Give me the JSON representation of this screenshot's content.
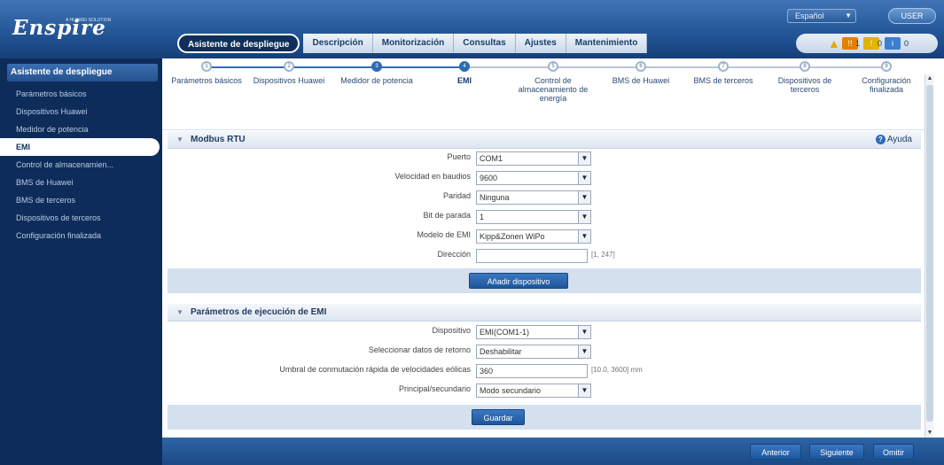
{
  "header": {
    "logo_text": "Enspire",
    "logo_subtext": "A HUAWEI SOLUTION",
    "language": "Español",
    "user": "USER"
  },
  "nav": {
    "tabs": [
      {
        "label": "Asistente de despliegue"
      },
      {
        "label": "Descripción"
      },
      {
        "label": "Monitorización"
      },
      {
        "label": "Consultas"
      },
      {
        "label": "Ajustes"
      },
      {
        "label": "Mantenimiento"
      }
    ],
    "alarms": {
      "major": "!!",
      "major_count": "1",
      "minor": "!",
      "minor_count": "0",
      "warning": "i",
      "warning_count": "0"
    }
  },
  "sidebar": {
    "title": "Asistente de despliegue",
    "items": [
      {
        "label": "Parámetros básicos"
      },
      {
        "label": "Dispositivos Huawei"
      },
      {
        "label": "Medidor de potencia"
      },
      {
        "label": "EMI"
      },
      {
        "label": "Control de almacenamien..."
      },
      {
        "label": "BMS de Huawei"
      },
      {
        "label": "BMS de terceros"
      },
      {
        "label": "Dispositivos de terceros"
      },
      {
        "label": "Configuración finalizada"
      }
    ]
  },
  "steps": [
    {
      "num": "1",
      "label": "Parámetros básicos"
    },
    {
      "num": "2",
      "label": "Dispositivos Huawei"
    },
    {
      "num": "3",
      "label": "Medidor de potencia"
    },
    {
      "num": "4",
      "label": "EMI"
    },
    {
      "num": "5",
      "label": "Control de almacenamiento de energía"
    },
    {
      "num": "6",
      "label": "BMS de Huawei"
    },
    {
      "num": "7",
      "label": "BMS de terceros"
    },
    {
      "num": "8",
      "label": "Dispositivos de terceros"
    },
    {
      "num": "9",
      "label": "Configuración finalizada"
    }
  ],
  "modbus": {
    "title": "Modbus RTU",
    "help": "Ayuda",
    "port_label": "Puerto",
    "port_value": "COM1",
    "baud_label": "Velocidad en baudios",
    "baud_value": "9600",
    "parity_label": "Paridad",
    "parity_value": "Ninguna",
    "stopbit_label": "Bit de parada",
    "stopbit_value": "1",
    "model_label": "Modelo de EMI",
    "model_value": "Kipp&Zonen WiPo",
    "address_label": "Dirección",
    "address_value": "",
    "address_hint": "[1, 247]",
    "add_button": "Añadir dispositivo"
  },
  "runparams": {
    "title": "Parámetros de ejecución de EMI",
    "device_label": "Dispositivo",
    "device_value": "EMI(COM1-1)",
    "data_label": "Seleccionar datos de retorno",
    "data_value": "Deshabilitar",
    "threshold_label": "Umbral de conmutación rápida de velocidades eólicas",
    "threshold_value": "360",
    "threshold_hint": "[10.0, 3600] mm",
    "mode_label": "Principal/secundario",
    "mode_value": "Modo secundario",
    "save_button": "Guardar"
  },
  "footer": {
    "prev": "Anterior",
    "next": "Siguiente",
    "skip": "Omitir"
  }
}
